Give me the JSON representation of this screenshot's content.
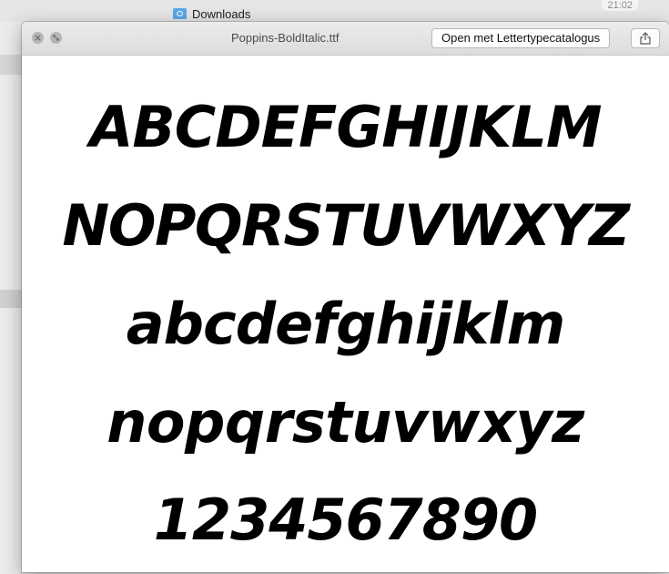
{
  "background_window": {
    "folder_label": "Downloads",
    "time": "21:02"
  },
  "quicklook": {
    "title": "Poppins-BoldItalic.ttf",
    "open_button_label": "Open met Lettertypecatalogus",
    "icons": {
      "close": "close-icon",
      "zoom": "fullscreen-icon",
      "share": "share-icon"
    },
    "preview_lines": [
      "ABCDEFGHIJKLM",
      "NOPQRSTUVWXYZ",
      "abcdefghijklm",
      "nopqrstuvwxyz",
      "1234567890"
    ]
  }
}
